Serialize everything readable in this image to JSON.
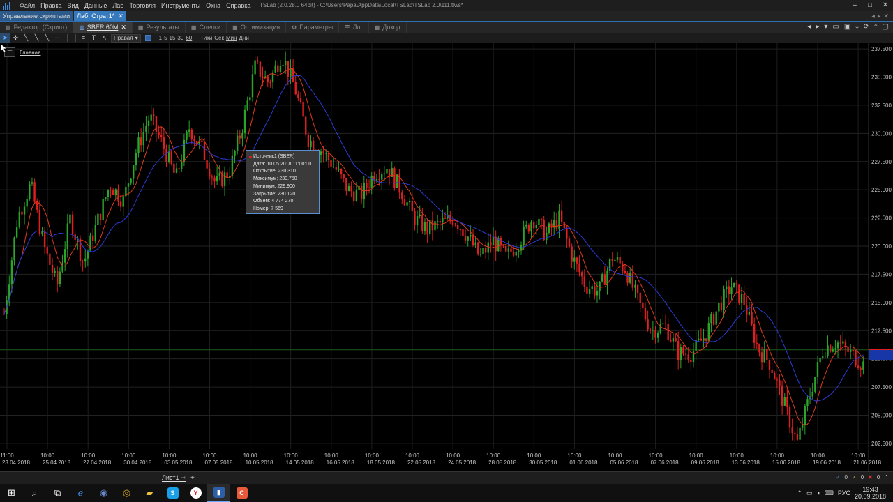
{
  "window": {
    "title": "TSLab (2.0.28.0 64bit) - C:\\Users\\Papa\\AppData\\Local\\TSLab\\TSLab 2.0\\111.tlws*",
    "menu": [
      "Файл",
      "Правка",
      "Вид",
      "Данные",
      "Лаб",
      "Торговля",
      "Инструменты",
      "Окна",
      "Справка"
    ]
  },
  "doc_tabs": [
    {
      "label": "Управление скриптами",
      "active": false
    },
    {
      "label": "Лаб: Страт1*",
      "active": true
    }
  ],
  "view_tabs": [
    {
      "label": "Редактор (Скрипт)",
      "icon": "editor-icon",
      "active": false
    },
    {
      "label": "SBER,60M",
      "icon": "chart-icon",
      "active": true
    },
    {
      "label": "Результаты",
      "icon": "results-icon",
      "active": false
    },
    {
      "label": "Сделки",
      "icon": "trades-icon",
      "active": false
    },
    {
      "label": "Оптимизация",
      "icon": "optimization-icon",
      "active": false
    },
    {
      "label": "Параметры",
      "icon": "gear-icon",
      "active": false
    },
    {
      "label": "Лог",
      "icon": "log-icon",
      "active": false
    },
    {
      "label": "Доход",
      "icon": "income-icon",
      "active": false
    }
  ],
  "toolbar": {
    "axis_dropdown": "Правая",
    "timeframes": [
      "1",
      "5",
      "15",
      "30",
      "60"
    ],
    "units": [
      "Тики",
      "Сек",
      "Мин",
      "Дни"
    ]
  },
  "chart_panel": {
    "title": "Главная"
  },
  "tooltip": {
    "title": "Источник1 (SBER)",
    "lines": [
      "Дата: 10.05.2018 11:00:00",
      "Открытие: 230.310",
      "Максимум: 230.750",
      "Минимум: 229.900",
      "Закрытие: 230.120",
      "Объем: 4 774 270",
      "Номер: 7 569"
    ]
  },
  "chart_data": {
    "type": "candlestick",
    "series": [
      {
        "name": "SBER,60M",
        "kind": "candles",
        "up_color": "#2aa52a",
        "down_color": "#e02020"
      },
      {
        "name": "",
        "kind": "line",
        "color": "#e03a1a"
      },
      {
        "name": "",
        "kind": "line",
        "color": "#2b3bd8"
      }
    ],
    "y_axis": {
      "ticks": [
        "237.500",
        "235.000",
        "232.500",
        "230.000",
        "227.500",
        "225.000",
        "222.500",
        "220.000",
        "217.500",
        "215.000",
        "212.500",
        "210.000",
        "207.500",
        "205.000",
        "202.500"
      ],
      "ylim": [
        202.0,
        238.0
      ]
    },
    "x_axis": {
      "ticks": [
        {
          "time": "11:00",
          "date": "23.04.2018"
        },
        {
          "time": "10:00",
          "date": "25.04.2018"
        },
        {
          "time": "10:00",
          "date": "27.04.2018"
        },
        {
          "time": "10:00",
          "date": "30.04.2018"
        },
        {
          "time": "10:00",
          "date": "03.05.2018"
        },
        {
          "time": "10:00",
          "date": "07.05.2018"
        },
        {
          "time": "10:00",
          "date": "10.05.2018"
        },
        {
          "time": "10:00",
          "date": "14.05.2018"
        },
        {
          "time": "10:00",
          "date": "16.05.2018"
        },
        {
          "time": "10:00",
          "date": "18.05.2018"
        },
        {
          "time": "10:00",
          "date": "22.05.2018"
        },
        {
          "time": "10:00",
          "date": "24.05.2018"
        },
        {
          "time": "10:00",
          "date": "28.05.2018"
        },
        {
          "time": "10:00",
          "date": "30.05.2018"
        },
        {
          "time": "10:00",
          "date": "01.06.2018"
        },
        {
          "time": "10:00",
          "date": "05.06.2018"
        },
        {
          "time": "10:00",
          "date": "07.06.2018"
        },
        {
          "time": "10:00",
          "date": "09.06.2018"
        },
        {
          "time": "10:00",
          "date": "13.06.2018"
        },
        {
          "time": "10:00",
          "date": "15.06.2018"
        },
        {
          "time": "10:00",
          "date": "19.06.2018"
        },
        {
          "time": "10:00",
          "date": "21.06.2018"
        }
      ]
    },
    "price_path": [
      [
        0,
        214.0
      ],
      [
        1,
        222.5
      ],
      [
        2,
        225.5
      ],
      [
        3,
        220.0
      ],
      [
        4,
        216.5
      ],
      [
        5,
        222.5
      ],
      [
        6,
        218.5
      ],
      [
        7,
        222.0
      ],
      [
        8,
        225.5
      ],
      [
        9,
        224.0
      ],
      [
        10,
        228.5
      ],
      [
        11,
        231.5
      ],
      [
        12,
        229.0
      ],
      [
        13,
        226.0
      ],
      [
        14,
        230.5
      ],
      [
        15,
        228.5
      ],
      [
        16,
        225.5
      ],
      [
        17,
        226.5
      ],
      [
        18,
        230.5
      ],
      [
        19,
        236.0
      ],
      [
        20,
        234.5
      ],
      [
        21,
        237.0
      ],
      [
        22,
        234.0
      ],
      [
        23,
        229.5
      ],
      [
        24,
        228.5
      ],
      [
        25,
        227.0
      ],
      [
        26,
        225.0
      ],
      [
        27,
        224.5
      ],
      [
        28,
        226.5
      ],
      [
        29,
        227.0
      ],
      [
        30,
        225.0
      ],
      [
        31,
        222.5
      ],
      [
        32,
        221.5
      ],
      [
        33,
        222.0
      ],
      [
        34,
        222.5
      ],
      [
        35,
        221.0
      ],
      [
        36,
        219.0
      ],
      [
        37,
        220.5
      ],
      [
        38,
        219.0
      ],
      [
        39,
        220.5
      ],
      [
        40,
        222.5
      ],
      [
        41,
        221.0
      ],
      [
        42,
        222.5
      ],
      [
        43,
        219.0
      ],
      [
        44,
        216.5
      ],
      [
        45,
        216.0
      ],
      [
        46,
        219.0
      ],
      [
        47,
        218.0
      ],
      [
        48,
        215.0
      ],
      [
        49,
        212.5
      ],
      [
        50,
        213.0
      ],
      [
        51,
        210.5
      ],
      [
        52,
        210.5
      ],
      [
        53,
        212.0
      ],
      [
        54,
        214.5
      ],
      [
        55,
        216.5
      ],
      [
        56,
        215.0
      ],
      [
        57,
        211.0
      ],
      [
        58,
        209.5
      ],
      [
        59,
        206.0
      ],
      [
        60,
        202.5
      ],
      [
        61,
        207.0
      ],
      [
        62,
        211.0
      ],
      [
        63,
        211.5
      ],
      [
        64,
        210.5
      ],
      [
        65,
        209.5
      ]
    ],
    "price_path_note": "",
    "current_price_line": 210.8,
    "grid": true,
    "legend": "none"
  },
  "sheetbar": {
    "tab": "Лист1",
    "add": "+",
    "counters": [
      "0",
      "0",
      "0"
    ]
  },
  "taskbar": {
    "lang": "РУС",
    "time": "19:43",
    "date": "20.09.2018"
  }
}
